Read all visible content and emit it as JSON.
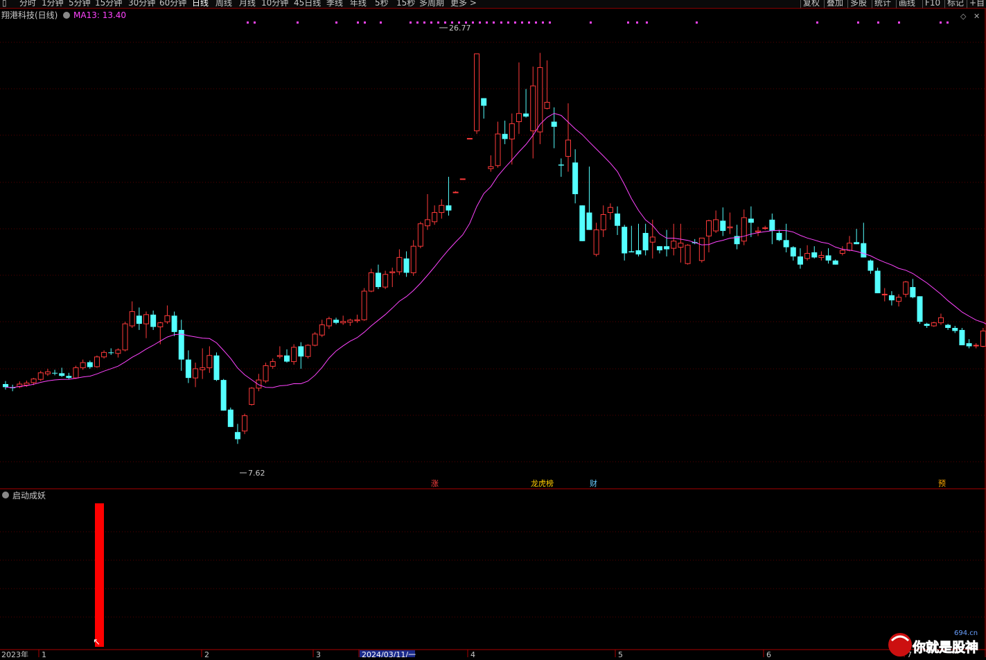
{
  "toolbar": {
    "items": [
      "分时",
      "1分钟",
      "5分钟",
      "15分钟",
      "30分钟",
      "60分钟",
      "日线",
      "周线",
      "月线",
      "10分钟",
      "45日线",
      "季线",
      "年线",
      "5秒",
      "15秒",
      "多周期",
      "更多 >"
    ],
    "active": "日线",
    "right_items": [
      "复权",
      "叠加",
      "多股",
      "统计",
      "画线",
      "F10",
      "标记",
      "+自"
    ]
  },
  "main_panel": {
    "title": "翔港科技(日线)",
    "ma_label": "MA13: 13.40",
    "ma_color": "#ff44ff",
    "max_label": "26.77",
    "min_label": "7.62",
    "event_markers": [
      {
        "text": "涨",
        "color": "#ff4040"
      },
      {
        "text": "龙虎榜",
        "color": "#ffcc00"
      },
      {
        "text": "财",
        "color": "#66ccff"
      },
      {
        "text": "预",
        "color": "#ffaa00"
      }
    ]
  },
  "indicator_panel": {
    "title": "启动成妖",
    "bar_color": "#ff0000"
  },
  "x_axis": {
    "labels": [
      "2023年",
      "1",
      "2",
      "3",
      "2024/03/11/一",
      "4",
      "5",
      "6",
      "7"
    ]
  },
  "watermark": {
    "text": "你就是股神",
    "site": "694.cn"
  },
  "colors": {
    "up": "#ff3a3a",
    "down": "#54ffff",
    "grid": "#5a0000"
  },
  "chart_data": {
    "type": "candlestick",
    "series_name": "翔港科技(日线)",
    "ma_period": 13,
    "ma_last": 13.4,
    "ylim": [
      6.0,
      28.0
    ],
    "max_price": 26.77,
    "min_price": 7.62,
    "ohlc": [
      [
        10.55,
        10.7,
        10.28,
        10.4
      ],
      [
        10.4,
        10.52,
        10.2,
        10.35
      ],
      [
        10.42,
        10.68,
        10.35,
        10.55
      ],
      [
        10.5,
        10.72,
        10.42,
        10.6
      ],
      [
        10.62,
        10.85,
        10.5,
        10.8
      ],
      [
        10.78,
        11.2,
        10.7,
        11.1
      ],
      [
        11.05,
        11.3,
        10.95,
        11.15
      ],
      [
        11.1,
        11.25,
        10.98,
        11.08
      ],
      [
        11.08,
        11.35,
        10.9,
        10.95
      ],
      [
        10.95,
        11.1,
        10.8,
        10.85
      ],
      [
        10.85,
        11.45,
        10.8,
        11.35
      ],
      [
        11.35,
        11.75,
        11.25,
        11.6
      ],
      [
        11.62,
        11.7,
        11.3,
        11.38
      ],
      [
        11.4,
        11.95,
        11.35,
        11.88
      ],
      [
        11.88,
        12.2,
        11.8,
        12.1
      ],
      [
        12.1,
        12.3,
        11.98,
        12.08
      ],
      [
        12.05,
        12.3,
        11.85,
        12.22
      ],
      [
        12.22,
        13.6,
        12.15,
        13.5
      ],
      [
        13.4,
        14.6,
        13.3,
        14.1
      ],
      [
        13.9,
        14.3,
        13.2,
        13.5
      ],
      [
        13.5,
        14.1,
        12.8,
        13.95
      ],
      [
        13.95,
        14.15,
        13.2,
        13.35
      ],
      [
        13.35,
        13.6,
        12.5,
        13.55
      ],
      [
        13.6,
        14.4,
        13.5,
        13.9
      ],
      [
        13.9,
        14.1,
        12.9,
        13.1
      ],
      [
        13.2,
        13.7,
        11.2,
        11.75
      ],
      [
        11.75,
        12.2,
        10.6,
        10.85
      ],
      [
        10.85,
        11.6,
        10.4,
        11.3
      ],
      [
        11.25,
        12.3,
        10.8,
        11.35
      ],
      [
        11.35,
        12.4,
        11.1,
        11.95
      ],
      [
        11.95,
        12.1,
        10.7,
        10.75
      ],
      [
        10.75,
        10.8,
        9.65,
        9.25
      ],
      [
        9.3,
        9.4,
        8.45,
        8.45
      ],
      [
        8.2,
        8.6,
        7.62,
        7.85
      ],
      [
        8.25,
        9.1,
        8.1,
        9.0
      ],
      [
        9.55,
        10.4,
        9.5,
        10.35
      ],
      [
        10.35,
        11.05,
        10.2,
        10.75
      ],
      [
        10.7,
        11.6,
        10.6,
        11.45
      ],
      [
        11.42,
        11.8,
        11.3,
        11.65
      ],
      [
        11.9,
        12.4,
        11.8,
        11.95
      ],
      [
        11.95,
        12.25,
        11.6,
        11.65
      ],
      [
        11.65,
        12.5,
        11.5,
        12.35
      ],
      [
        12.4,
        12.6,
        11.3,
        11.9
      ],
      [
        11.9,
        12.5,
        11.8,
        12.45
      ],
      [
        12.45,
        13.1,
        12.4,
        13.0
      ],
      [
        12.95,
        13.7,
        12.85,
        13.45
      ],
      [
        13.4,
        13.85,
        13.25,
        13.75
      ],
      [
        13.7,
        13.8,
        13.48,
        13.55
      ],
      [
        13.55,
        13.9,
        13.45,
        13.62
      ],
      [
        13.58,
        13.75,
        13.4,
        13.68
      ],
      [
        13.65,
        13.95,
        13.55,
        13.7
      ],
      [
        13.7,
        15.25,
        13.65,
        15.1
      ],
      [
        15.1,
        16.2,
        15.05,
        16.0
      ],
      [
        16.0,
        16.4,
        15.2,
        15.3
      ],
      [
        15.3,
        16.1,
        15.2,
        15.92
      ],
      [
        16.0,
        16.25,
        15.3,
        16.05
      ],
      [
        16.05,
        17.15,
        15.9,
        16.75
      ],
      [
        16.7,
        17.05,
        15.8,
        16.0
      ],
      [
        16.0,
        17.6,
        15.85,
        17.3
      ],
      [
        17.3,
        18.5,
        17.2,
        18.4
      ],
      [
        18.3,
        19.85,
        18.1,
        18.6
      ],
      [
        18.5,
        19.3,
        18.35,
        18.95
      ],
      [
        18.95,
        19.6,
        18.65,
        19.3
      ],
      [
        19.3,
        20.7,
        18.8,
        19.05
      ],
      [
        19.95,
        20.0,
        19.9,
        19.95
      ],
      [
        20.6,
        20.6,
        20.6,
        20.6
      ],
      [
        22.58,
        22.58,
        22.58,
        22.58
      ],
      [
        22.95,
        26.72,
        22.8,
        26.72
      ],
      [
        24.55,
        24.55,
        23.55,
        24.18
      ],
      [
        21.1,
        21.75,
        20.95,
        21.2
      ],
      [
        21.25,
        23.4,
        21.15,
        22.8
      ],
      [
        22.8,
        23.45,
        22.3,
        22.55
      ],
      [
        22.55,
        23.8,
        21.3,
        23.3
      ],
      [
        23.4,
        26.3,
        22.8,
        23.8
      ],
      [
        23.8,
        25.0,
        23.6,
        23.65
      ],
      [
        22.95,
        26.1,
        21.6,
        25.15
      ],
      [
        22.9,
        26.77,
        22.3,
        26.05
      ],
      [
        24.05,
        26.4,
        24.0,
        24.35
      ],
      [
        23.4,
        24.1,
        22.1,
        23.15
      ],
      [
        21.3,
        21.6,
        20.7,
        21.25
      ],
      [
        21.7,
        24.3,
        20.95,
        22.5
      ],
      [
        21.4,
        22.05,
        19.4,
        19.85
      ],
      [
        19.3,
        17.55,
        19.35,
        17.55
      ],
      [
        18.95,
        21.2,
        18.4,
        18.1
      ],
      [
        16.9,
        18.45,
        16.8,
        18.1
      ],
      [
        18.1,
        19.3,
        17.75,
        18.85
      ],
      [
        18.95,
        19.4,
        18.6,
        19.2
      ],
      [
        18.9,
        19.25,
        17.85,
        18.3
      ],
      [
        18.25,
        18.35,
        16.6,
        16.95
      ],
      [
        17.05,
        18.3,
        17.0,
        17.0
      ],
      [
        17.1,
        18.4,
        16.8,
        16.9
      ],
      [
        17.95,
        18.4,
        16.85,
        17.1
      ],
      [
        17.5,
        18.6,
        16.7,
        17.75
      ],
      [
        17.3,
        17.2,
        16.95,
        17.1
      ],
      [
        17.3,
        18.1,
        16.8,
        17.15
      ],
      [
        17.2,
        18.4,
        16.85,
        17.55
      ],
      [
        17.25,
        18.4,
        16.5,
        17.45
      ],
      [
        16.45,
        17.4,
        16.4,
        17.35
      ],
      [
        17.5,
        17.65,
        17.4,
        17.45
      ],
      [
        16.6,
        17.5,
        16.5,
        17.7
      ],
      [
        17.8,
        18.6,
        17.0,
        18.55
      ],
      [
        18.05,
        19.05,
        17.95,
        18.6
      ],
      [
        18.55,
        19.2,
        17.8,
        18.05
      ],
      [
        18.2,
        18.95,
        17.9,
        18.25
      ],
      [
        17.8,
        18.35,
        17.15,
        17.4
      ],
      [
        17.55,
        19.1,
        17.35,
        18.7
      ],
      [
        18.65,
        19.25,
        17.75,
        18.45
      ],
      [
        18.0,
        18.25,
        17.8,
        18.05
      ],
      [
        18.2,
        18.3,
        18.1,
        18.2
      ],
      [
        18.6,
        18.9,
        17.4,
        18.05
      ],
      [
        17.95,
        18.1,
        17.55,
        17.6
      ],
      [
        17.6,
        18.4,
        17.0,
        17.25
      ],
      [
        17.25,
        17.3,
        16.6,
        16.8
      ],
      [
        16.8,
        17.2,
        16.2,
        16.4
      ],
      [
        16.7,
        17.35,
        16.6,
        16.95
      ],
      [
        17.0,
        17.3,
        16.7,
        16.75
      ],
      [
        16.75,
        17.05,
        16.6,
        16.85
      ],
      [
        16.85,
        17.2,
        16.45,
        16.6
      ],
      [
        16.6,
        16.65,
        16.55,
        16.4
      ],
      [
        16.95,
        17.3,
        16.85,
        17.1
      ],
      [
        17.1,
        17.8,
        17.05,
        17.45
      ],
      [
        17.5,
        18.15,
        17.4,
        17.4
      ],
      [
        17.45,
        18.45,
        16.9,
        16.75
      ],
      [
        16.6,
        16.65,
        15.95,
        16.1
      ],
      [
        16.1,
        16.25,
        15.55,
        15.0
      ],
      [
        14.95,
        15.25,
        14.6,
        14.95
      ],
      [
        14.9,
        15.1,
        14.4,
        14.65
      ],
      [
        14.6,
        14.95,
        14.35,
        14.8
      ],
      [
        14.95,
        15.6,
        14.8,
        15.55
      ],
      [
        15.3,
        15.7,
        14.75,
        14.8
      ],
      [
        14.85,
        14.6,
        13.5,
        13.6
      ],
      [
        13.5,
        13.55,
        13.3,
        13.4
      ],
      [
        13.4,
        13.6,
        13.35,
        13.55
      ],
      [
        13.55,
        14.0,
        13.45,
        13.8
      ],
      [
        13.45,
        13.5,
        13.2,
        13.3
      ],
      [
        13.3,
        13.4,
        13.05,
        13.15
      ],
      [
        13.2,
        13.3,
        12.45,
        12.45
      ],
      [
        12.55,
        12.75,
        12.3,
        12.4
      ],
      [
        12.45,
        12.55,
        12.3,
        12.45
      ],
      [
        12.4,
        13.3,
        12.35,
        13.15
      ],
      [
        13.1,
        13.15,
        12.45,
        12.45
      ],
      [
        12.4,
        12.55,
        12.3,
        12.4
      ],
      [
        12.45,
        12.95,
        12.4,
        12.9
      ],
      [
        12.9,
        13.1,
        12.3,
        12.35
      ],
      [
        12.3,
        12.55,
        12.05,
        12.1
      ],
      [
        12.1,
        12.25,
        11.9,
        12.0
      ],
      [
        11.95,
        12.05,
        11.55,
        11.6
      ],
      [
        11.6,
        12.4,
        11.5,
        11.75
      ],
      [
        12.75,
        12.95,
        11.45,
        11.6
      ],
      [
        11.25,
        11.65,
        11.15,
        11.6
      ],
      [
        11.55,
        11.8,
        11.45,
        11.75
      ]
    ],
    "indicator_bars": [
      {
        "index": 17,
        "value": 1.0
      }
    ],
    "x_tick_labels": [
      "2023年",
      "1",
      "2",
      "3",
      "2024/03/11/一",
      "4",
      "5",
      "6",
      "7"
    ]
  }
}
